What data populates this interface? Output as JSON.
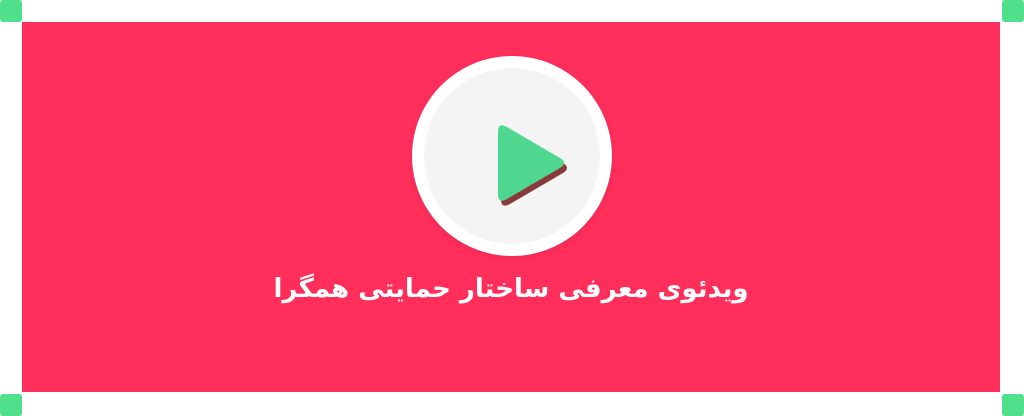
{
  "banner": {
    "background_color": "#ff2e5a",
    "caption": "ویدئوی معرفی ساختار حمایتی همگرا"
  },
  "play_button": {
    "icon": "play-icon",
    "icon_color": "#4fd68f",
    "shadow_color": "#8a3a3a"
  },
  "frame": {
    "corner_handle_color": "#4fe08c"
  }
}
